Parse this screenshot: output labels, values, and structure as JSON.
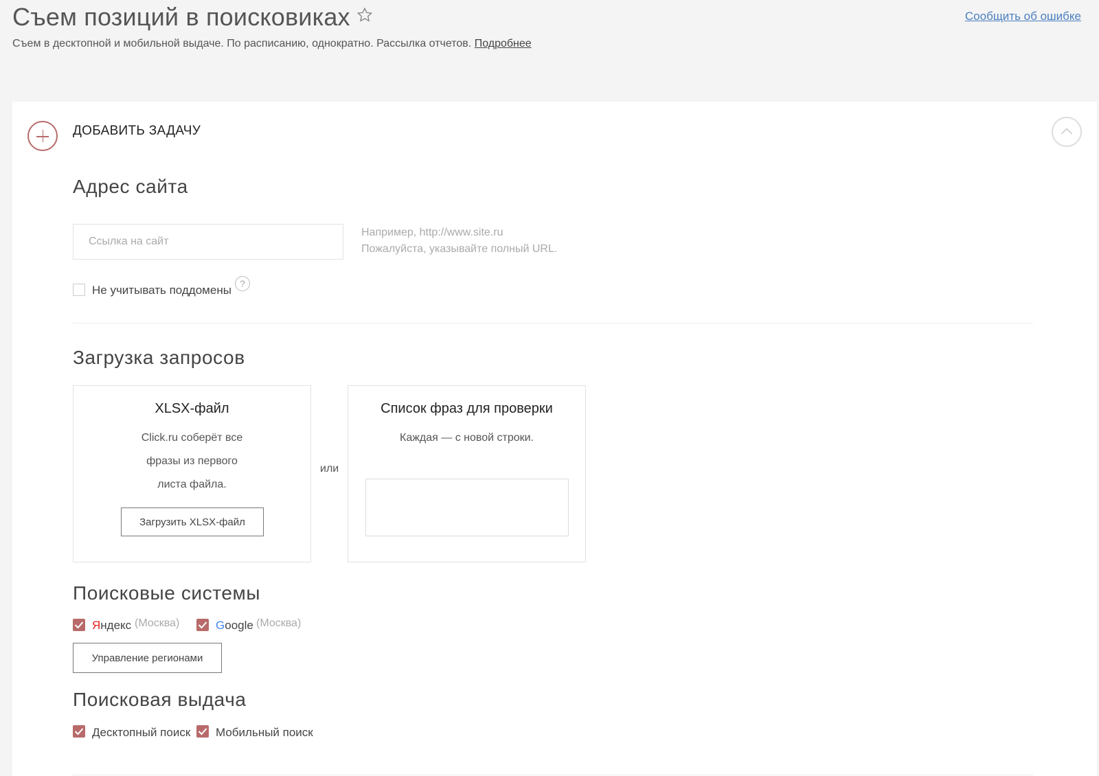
{
  "header": {
    "title": "Съем позиций в поисковиках",
    "subtitle": "Съем в десктопной и мобильной выдаче. По расписанию, однократно. Рассылка отчетов.",
    "more_link": "Подробнее",
    "report_link": "Сообщить об ошибке"
  },
  "panel": {
    "add_task_title": "ДОБАВИТЬ ЗАДАЧУ",
    "site_section": {
      "title": "Адрес сайта",
      "url_placeholder": "Ссылка на сайт",
      "url_value": "",
      "hint_line1": "Например, http://www.site.ru",
      "hint_line2": "Пожалуйста, указывайте полный URL.",
      "ignore_subdomains_label": "Не учитывать поддомены",
      "ignore_subdomains_checked": false,
      "help_icon_glyph": "?"
    },
    "queries_section": {
      "title": "Загрузка запросов",
      "xlsx_card": {
        "title": "XLSX-файл",
        "text_line1": "Click.ru соберёт все",
        "text_line2": "фразы из первого",
        "text_line3": "листа файла.",
        "button_label": "Загрузить XLSX-файл"
      },
      "or_label": "или",
      "phrases_card": {
        "title": "Список фраз для проверки",
        "text": "Каждая — с новой строки.",
        "textarea_value": ""
      }
    },
    "search_engines_section": {
      "title": "Поисковые системы",
      "yandex": {
        "first_letter": "Я",
        "rest": "ндекс",
        "region": "(Москва)",
        "checked": true
      },
      "google": {
        "first_letter": "G",
        "rest": "oogle",
        "region": "(Москва)",
        "checked": true
      },
      "regions_button_label": "Управление регионами"
    },
    "serp_section": {
      "title": "Поисковая выдача",
      "desktop_label": "Десктопный поиск",
      "desktop_checked": true,
      "mobile_label": "Мобильный поиск",
      "mobile_checked": true
    }
  },
  "colors": {
    "accent": "#b86a6a",
    "link": "#4a7fc1",
    "yandex_red": "#e52620",
    "google_blue": "#4285f4"
  },
  "icons": {
    "star": "star-icon",
    "add": "plus-circle-icon",
    "collapse": "chevron-up-icon",
    "help": "question-circle-icon",
    "check": "checkmark-icon"
  }
}
